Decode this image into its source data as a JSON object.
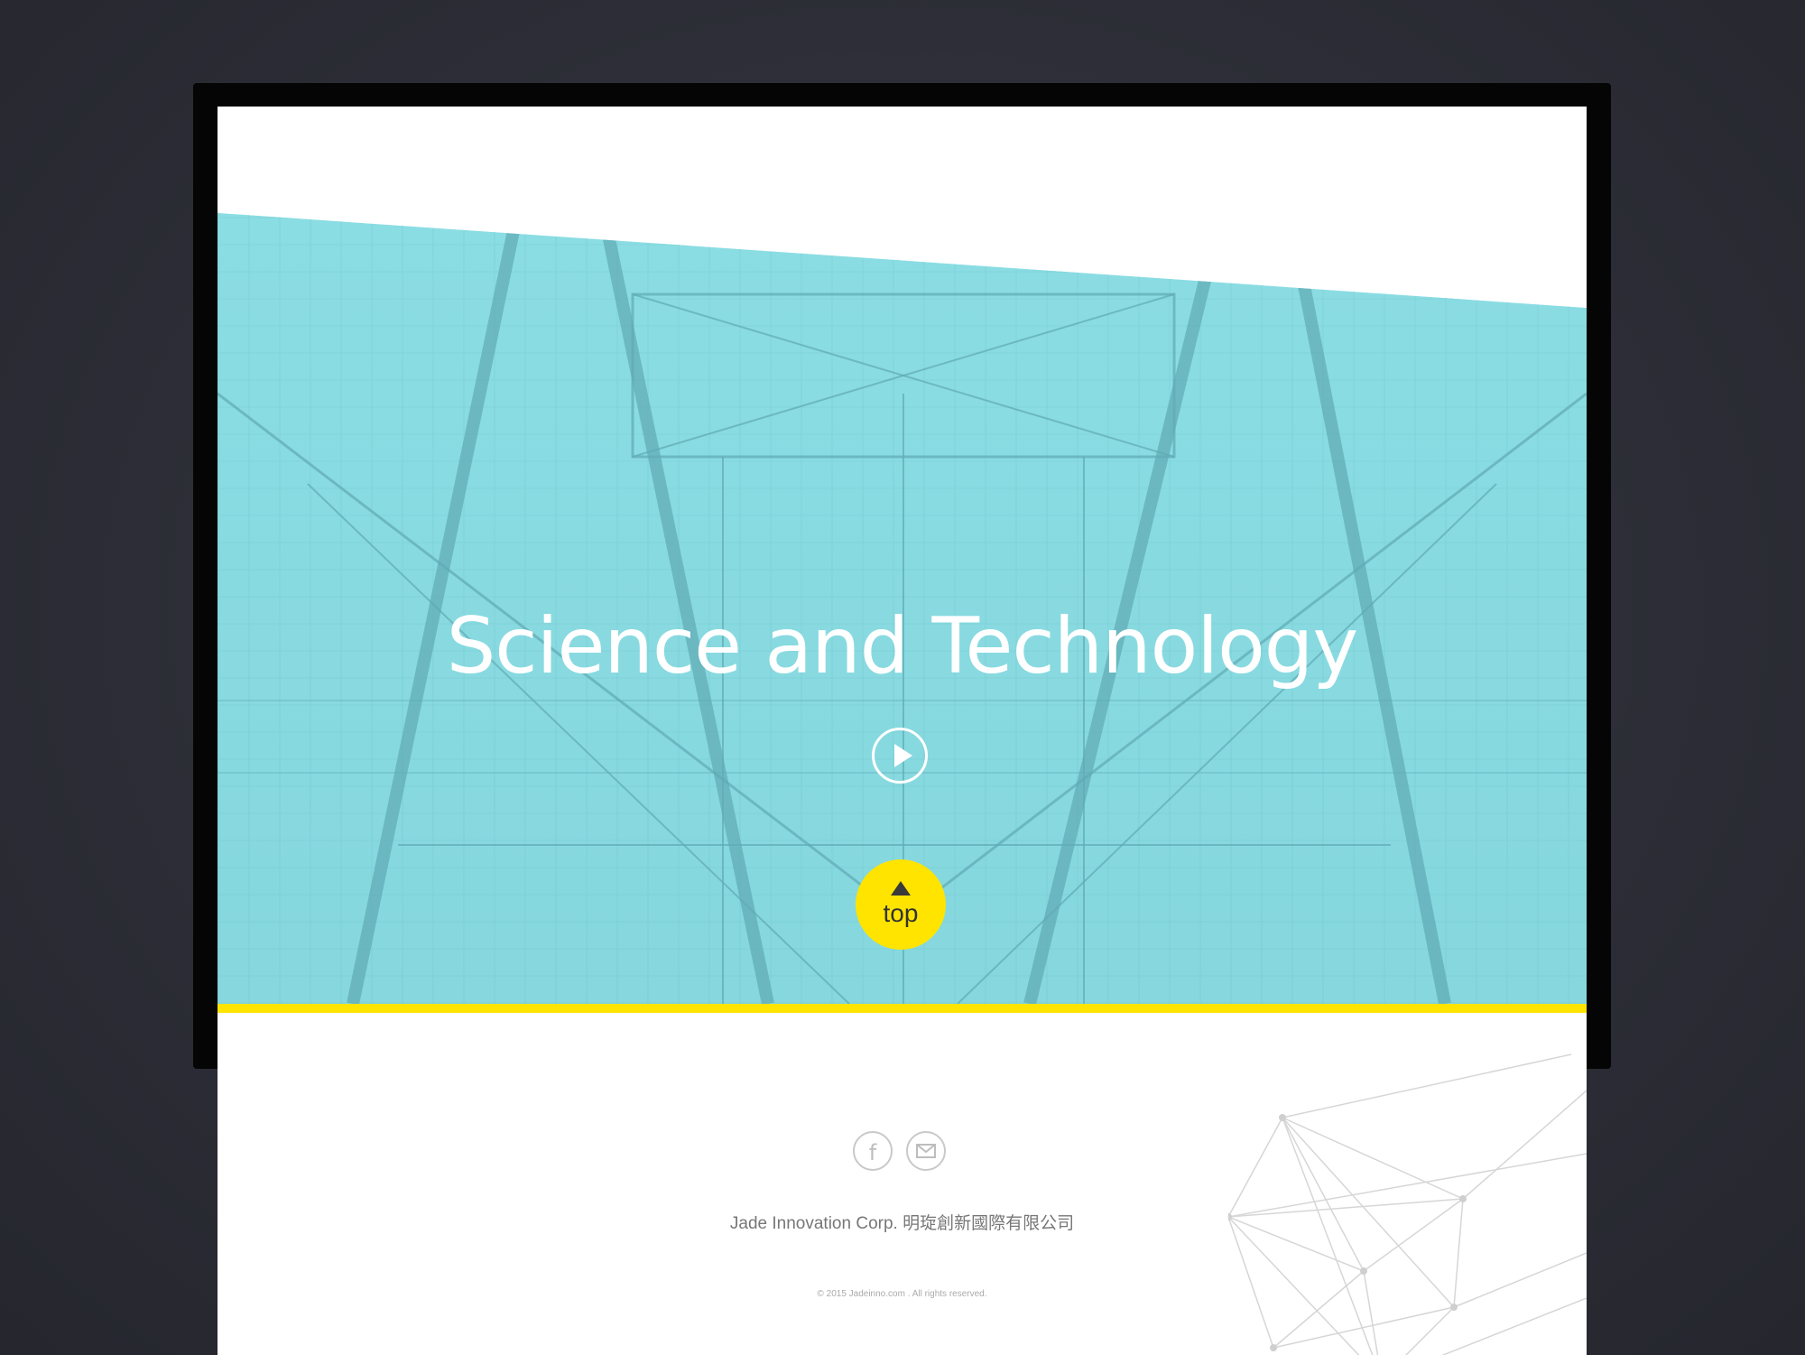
{
  "hero": {
    "title": "Science and Technology",
    "play_icon": "play-circle-icon",
    "overlay_color": "#8edde3"
  },
  "top_button": {
    "label": "top",
    "icon": "arrow-up-icon",
    "color": "#ffe400"
  },
  "footer": {
    "social": [
      {
        "icon": "facebook-icon",
        "glyph": "f"
      },
      {
        "icon": "mail-icon"
      }
    ],
    "company": "Jade Innovation Corp.  明琁創新國際有限公司",
    "copyright": "© 2015 Jadeinno.com . All rights reserved."
  },
  "colors": {
    "accent": "#ffe400",
    "background": "#2c2d36",
    "bezel": "#050505"
  }
}
